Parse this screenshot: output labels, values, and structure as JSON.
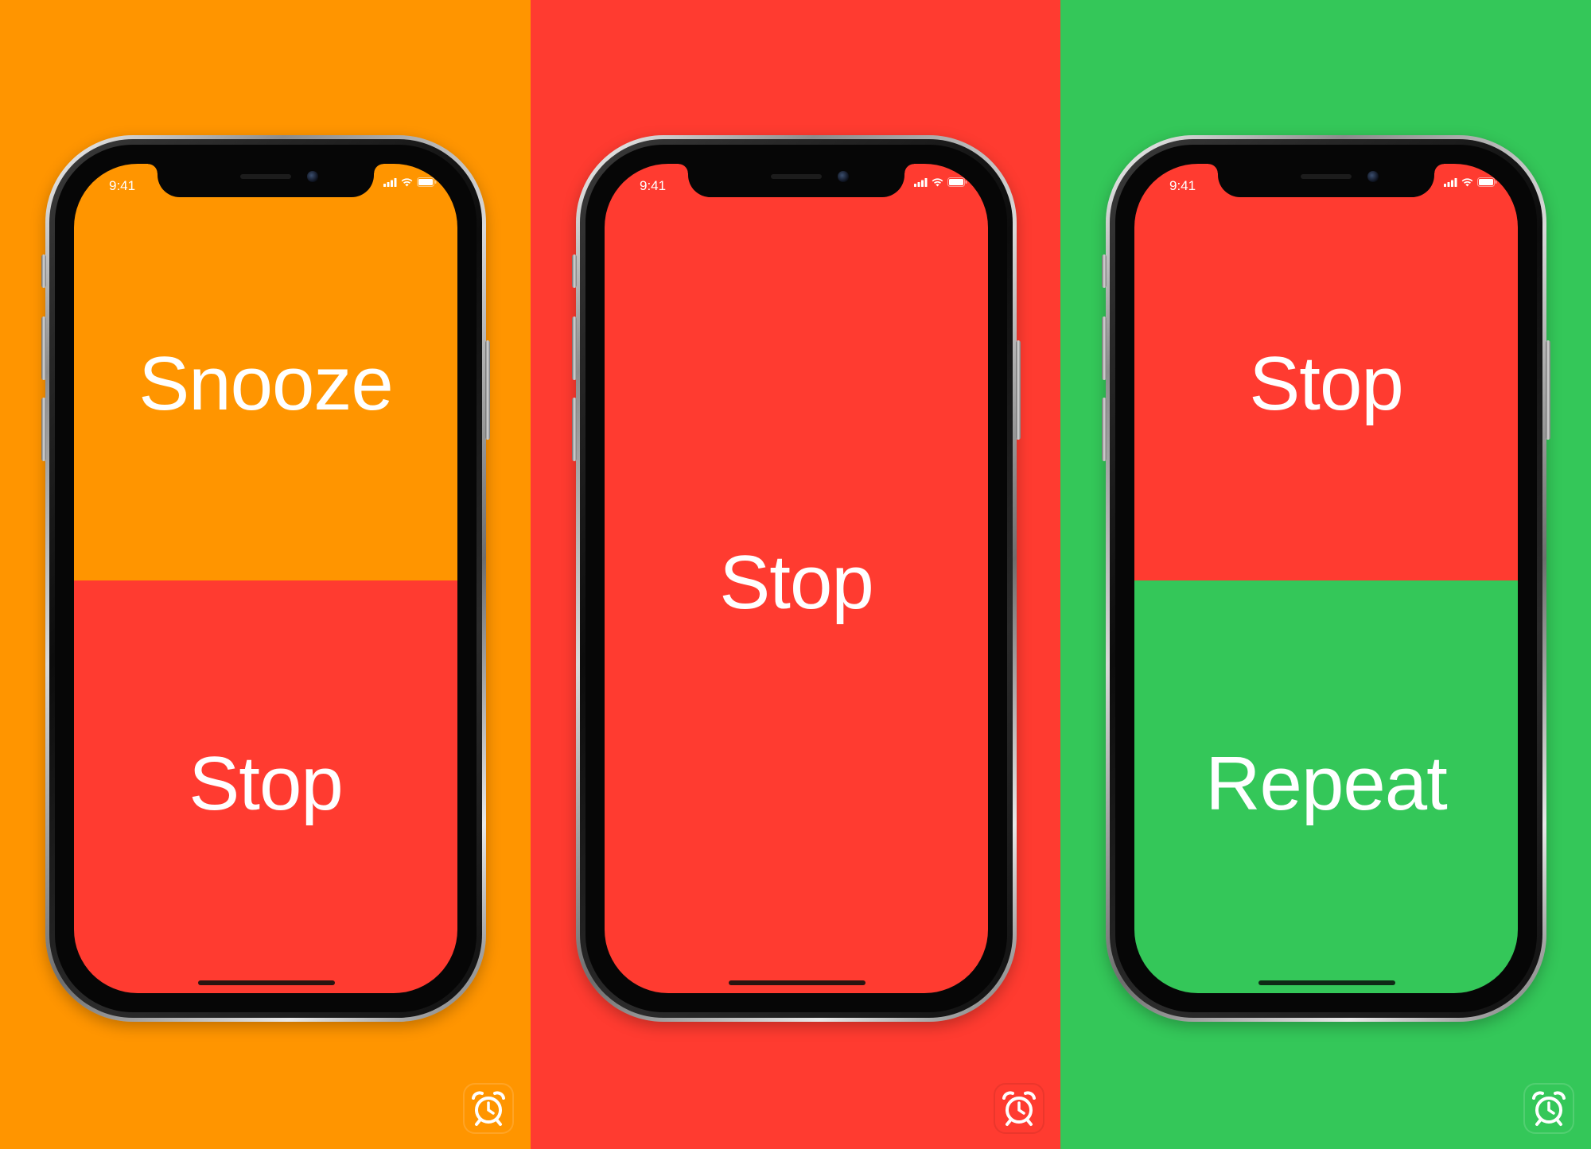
{
  "colors": {
    "orange": "#FF9500",
    "red": "#FF3B30",
    "green": "#34C759",
    "text": "#FFFFFF"
  },
  "status_bar": {
    "time": "9:41",
    "icons": [
      "signal-icon",
      "wifi-icon",
      "battery-icon"
    ]
  },
  "panels": [
    {
      "background": "#FF9500",
      "top_button": {
        "label": "Snooze",
        "color": "#FF9500"
      },
      "bottom_button": {
        "label": "Stop",
        "color": "#FF3B30"
      },
      "app_icon": {
        "name": "alarm-clock-icon",
        "color": "#FF9500"
      }
    },
    {
      "background": "#FF3B30",
      "full_button": {
        "label": "Stop",
        "color": "#FF3B30"
      },
      "app_icon": {
        "name": "alarm-clock-icon",
        "color": "#FF3B30"
      }
    },
    {
      "background": "#34C759",
      "top_button": {
        "label": "Stop",
        "color": "#FF3B30"
      },
      "bottom_button": {
        "label": "Repeat",
        "color": "#34C759"
      },
      "app_icon": {
        "name": "alarm-clock-icon",
        "color": "#34C759"
      }
    }
  ]
}
